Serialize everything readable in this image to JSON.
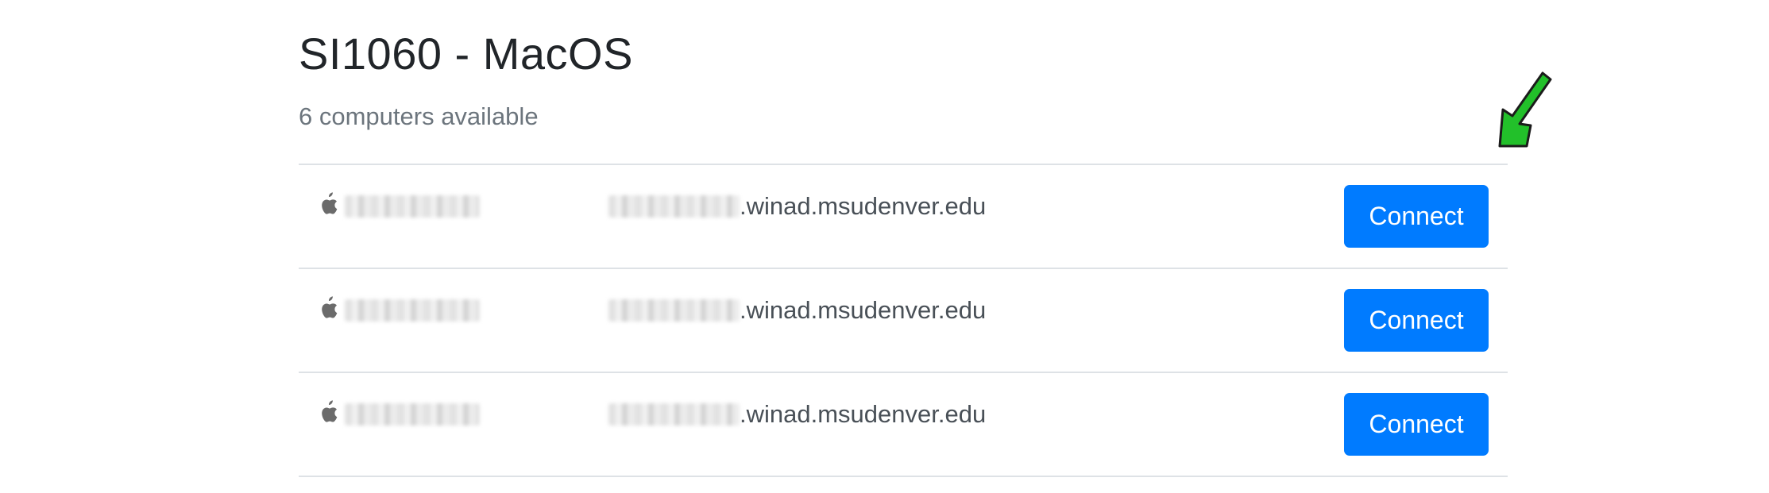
{
  "lab": {
    "title": "SI1060 - MacOS",
    "subtitle": "6 computers available"
  },
  "computers": [
    {
      "icon": "apple-icon",
      "host_domain": ".winad.msudenver.edu",
      "connect_label": "Connect"
    },
    {
      "icon": "apple-icon",
      "host_domain": ".winad.msudenver.edu",
      "connect_label": "Connect"
    },
    {
      "icon": "apple-icon",
      "host_domain": ".winad.msudenver.edu",
      "connect_label": "Connect"
    }
  ],
  "annotation": {
    "icon": "arrow-down-left-icon",
    "color": "#22c02a"
  },
  "colors": {
    "primary_button": "#007bff",
    "divider": "#dee2e6",
    "muted_text": "#6c757d"
  }
}
